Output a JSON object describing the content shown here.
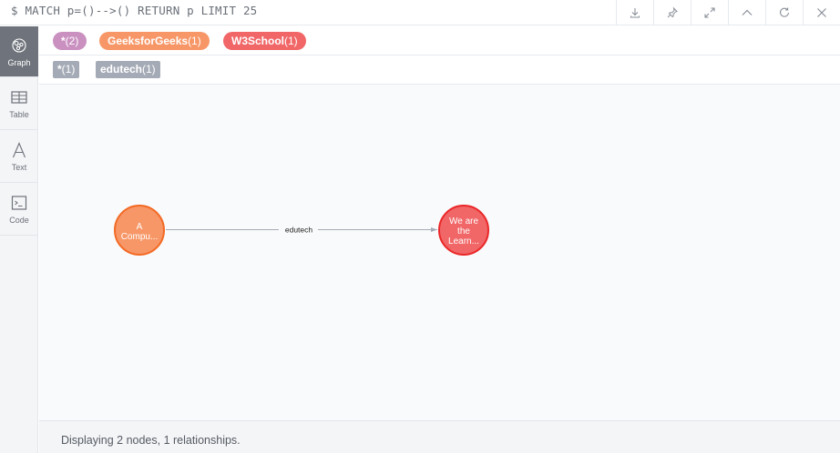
{
  "query": "$ MATCH p=()-->() RETURN p LIMIT 25",
  "toolbar": {
    "actions": [
      {
        "name": "download-icon"
      },
      {
        "name": "pin-icon"
      },
      {
        "name": "expand-icon"
      },
      {
        "name": "collapse-icon"
      },
      {
        "name": "rerun-icon"
      },
      {
        "name": "close-icon"
      }
    ]
  },
  "sidebar": {
    "tabs": [
      {
        "label": "Graph",
        "icon": "graph-icon",
        "active": true
      },
      {
        "label": "Table",
        "icon": "table-icon",
        "active": false
      },
      {
        "label": "Text",
        "icon": "text-icon",
        "active": false
      },
      {
        "label": "Code",
        "icon": "code-icon",
        "active": false
      }
    ]
  },
  "legend": {
    "node_labels": [
      {
        "name": "*",
        "count": "(2)",
        "color": "#c990c0"
      },
      {
        "name": "GeeksforGeeks",
        "count": "(1)",
        "color": "#f79767"
      },
      {
        "name": "W3School",
        "count": "(1)",
        "color": "#f16667"
      }
    ],
    "relationship_types": [
      {
        "name": "*",
        "count": "(1)",
        "color": "#a5abb6"
      },
      {
        "name": "edutech",
        "count": "(1)",
        "color": "#a5abb6"
      }
    ]
  },
  "graph": {
    "nodes": [
      {
        "lines": [
          "A",
          "Compu..."
        ],
        "fill": "#f79767",
        "stroke": "#f36924"
      },
      {
        "lines": [
          "We are",
          "the",
          "Learn..."
        ],
        "fill": "#f16667",
        "stroke": "#eb2728"
      }
    ],
    "relationships": [
      {
        "label": "edutech",
        "color": "#a5abb6"
      }
    ]
  },
  "status": "Displaying 2 nodes, 1 relationships."
}
